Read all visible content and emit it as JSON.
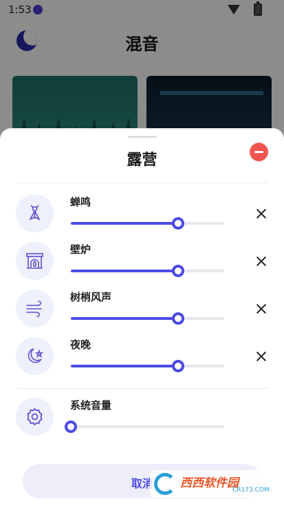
{
  "status_bar": {
    "time": "1:53"
  },
  "app": {
    "title": "混音"
  },
  "sheet": {
    "title": "露营",
    "sounds": [
      {
        "label": "蝉鸣",
        "icon": "cicada-icon",
        "level": 0.7
      },
      {
        "label": "壁炉",
        "icon": "fireplace-icon",
        "level": 0.7
      },
      {
        "label": "树梢风声",
        "icon": "wind-icon",
        "level": 0.7
      },
      {
        "label": "夜晚",
        "icon": "night-moon-icon",
        "level": 0.7
      }
    ],
    "system_volume": {
      "label": "系统音量",
      "icon": "gear-icon",
      "level": 0.0
    },
    "cancel_label": "取消"
  },
  "watermark": {
    "text": "西西软件园",
    "sub": "CR173.COM"
  },
  "colors": {
    "accent": "#4b4ae6",
    "remove": "#f0554f",
    "icon_bg": "#eef0fb"
  }
}
